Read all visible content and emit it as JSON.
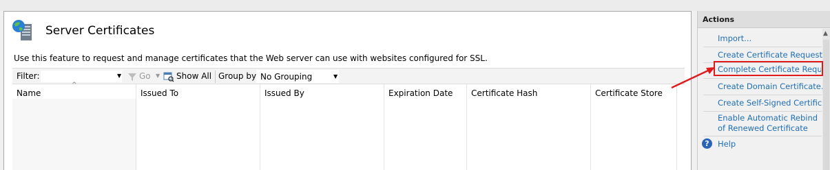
{
  "page": {
    "title": "Server Certificates",
    "description": "Use this feature to request and manage certificates that the Web server can use with websites configured for SSL.",
    "icon": "server-globe-icon"
  },
  "toolbar": {
    "filter_label": "Filter:",
    "go_label": "Go",
    "show_all_label": "Show All",
    "group_by_label": "Group by:",
    "group_by_value": "No Grouping"
  },
  "table": {
    "columns": [
      "Name",
      "Issued To",
      "Issued By",
      "Expiration Date",
      "Certificate Hash",
      "Certificate Store"
    ],
    "rows": []
  },
  "actions": {
    "title": "Actions",
    "items": [
      "Import...",
      "Create Certificate Request...",
      "Complete Certificate Request...",
      "Create Domain Certificate...",
      "Create Self-Signed Certificate...",
      "Enable Automatic Rebind of Renewed Certificate",
      "Help"
    ],
    "highlighted_item": "Complete Certificate Request..."
  },
  "colors": {
    "link": "#1f6eb7",
    "highlight": "#e01b1b"
  }
}
